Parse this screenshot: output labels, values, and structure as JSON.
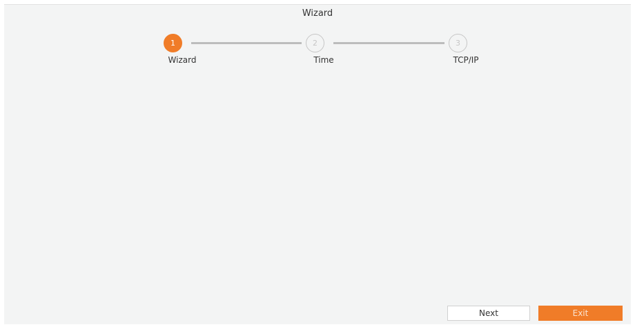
{
  "window": {
    "title": "Wizard"
  },
  "steps": [
    {
      "number": "1",
      "label": "Wizard",
      "state": "active"
    },
    {
      "number": "2",
      "label": "Time",
      "state": "inactive"
    },
    {
      "number": "3",
      "label": "TCP/IP",
      "state": "inactive"
    }
  ],
  "buttons": {
    "next_label": "Next",
    "exit_label": "Exit"
  },
  "colors": {
    "accent": "#f07c28",
    "inactive": "#c6c6c6",
    "background": "#f3f4f4"
  }
}
